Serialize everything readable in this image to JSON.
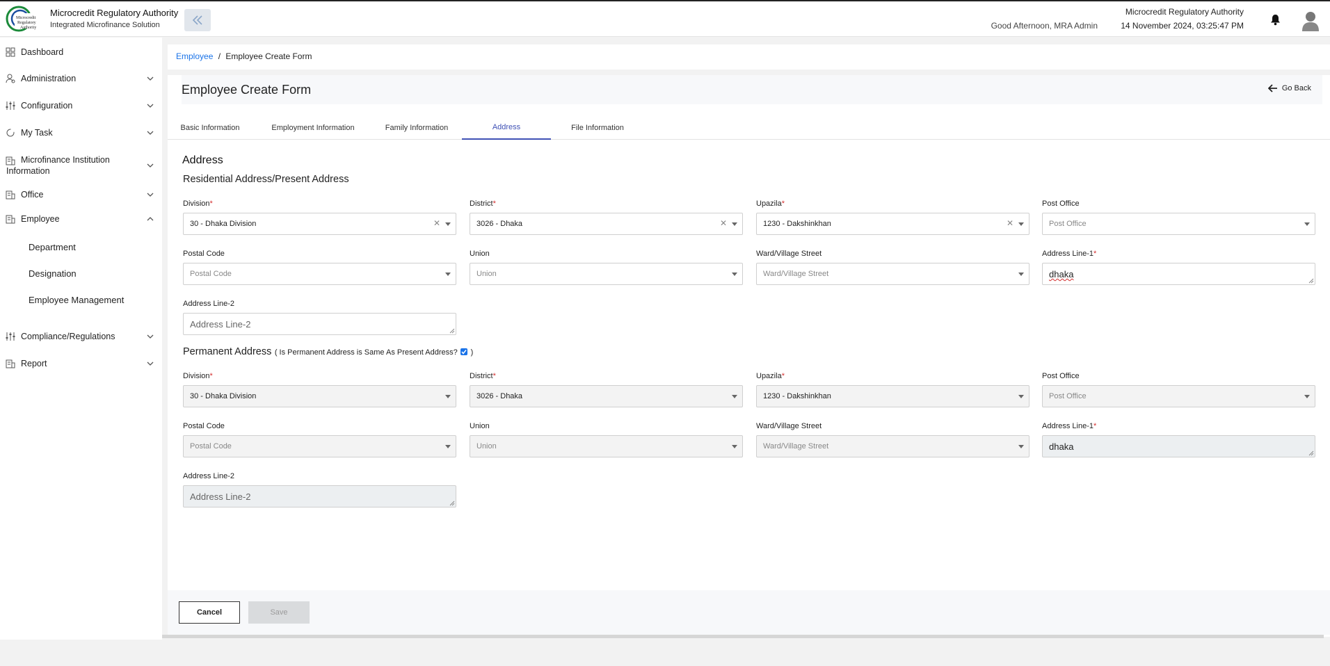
{
  "header": {
    "brand_title": "Microcredit Regulatory Authority",
    "brand_subtitle": "Integrated Microfinance Solution",
    "logo_text": "Microcredit Regulatory Authority",
    "greeting": "Good Afternoon, MRA Admin",
    "org_name": "Microcredit Regulatory Authority",
    "datetime": "14 November 2024, 03:25:47 PM"
  },
  "sidebar": {
    "items": [
      {
        "label": "Dashboard",
        "icon": "grid-icon"
      },
      {
        "label": "Administration",
        "icon": "user-gear-icon"
      },
      {
        "label": "Configuration",
        "icon": "sliders-icon"
      },
      {
        "label": "My Task",
        "icon": "refresh-icon"
      },
      {
        "label": "Microfinance Institution Information",
        "icon": "building-icon"
      },
      {
        "label": "Office",
        "icon": "building-icon"
      },
      {
        "label": "Employee",
        "icon": "building-icon"
      },
      {
        "label": "Compliance/Regulations",
        "icon": "sliders-icon"
      },
      {
        "label": "Report",
        "icon": "building-icon"
      }
    ],
    "employee_sub": [
      "Department",
      "Designation",
      "Employee Management"
    ]
  },
  "breadcrumb": {
    "parent": "Employee",
    "separator": "/",
    "current": "Employee Create Form"
  },
  "page": {
    "title": "Employee Create Form",
    "go_back": "Go Back"
  },
  "tabs": [
    "Basic Information",
    "Employment Information",
    "Family Information",
    "Address",
    "File Information"
  ],
  "active_tab": "Address",
  "address": {
    "section_title": "Address",
    "present_title": "Residential Address/Present Address",
    "permanent_title": "Permanent Address",
    "permanent_note_open": "( Is Permanent Address is Same As Present Address?",
    "permanent_note_close": ")",
    "same_as_present": true,
    "labels": {
      "division": "Division",
      "district": "District",
      "upazila": "Upazila",
      "post_office": "Post Office",
      "postal_code": "Postal Code",
      "union": "Union",
      "ward": "Ward/Village Street",
      "line1": "Address Line-1",
      "line2": "Address Line-2",
      "required_mark": "*"
    },
    "present": {
      "division": "30 - Dhaka Division",
      "district": "3026 - Dhaka",
      "upazila": "1230 - Dakshinkhan",
      "post_office_ph": "Post Office",
      "postal_code_ph": "Postal Code",
      "union_ph": "Union",
      "ward_ph": "Ward/Village Street",
      "line1": "dhaka",
      "line2_ph": "Address Line-2"
    },
    "permanent": {
      "division": "30 - Dhaka Division",
      "district": "3026 - Dhaka",
      "upazila": "1230 - Dakshinkhan",
      "post_office_ph": "Post Office",
      "postal_code_ph": "Postal Code",
      "union_ph": "Union",
      "ward_ph": "Ward/Village Street",
      "line1": "dhaka",
      "line2_ph": "Address Line-2"
    }
  },
  "actions": {
    "cancel": "Cancel",
    "save": "Save"
  },
  "colors": {
    "accent": "#3f51b5",
    "link": "#1a73e8",
    "required": "#d32f2f"
  }
}
